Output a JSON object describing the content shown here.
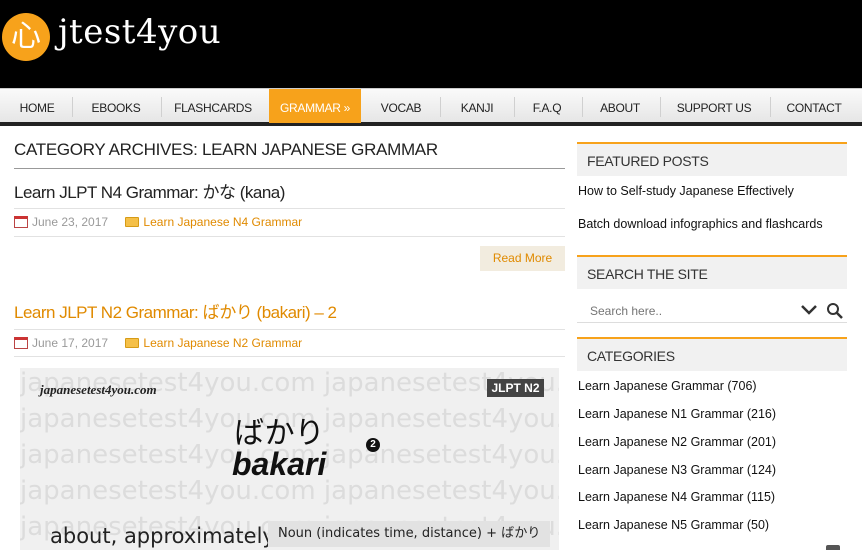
{
  "header": {
    "logo_glyph": "心",
    "site_name": "jtest4you"
  },
  "nav": {
    "items": [
      {
        "label": "HOME"
      },
      {
        "label": "EBOOKS"
      },
      {
        "label": "FLASHCARDS"
      },
      {
        "label": "GRAMMAR »",
        "active": true
      },
      {
        "label": "VOCAB"
      },
      {
        "label": "KANJI"
      },
      {
        "label": "F.A.Q"
      },
      {
        "label": "ABOUT"
      },
      {
        "label": "SUPPORT US"
      },
      {
        "label": "CONTACT"
      }
    ],
    "accent": "#f7a21b"
  },
  "main": {
    "category_title": "CATEGORY ARCHIVES: LEARN JAPANESE GRAMMAR",
    "posts": [
      {
        "title": "Learn JLPT N4 Grammar: かな (kana)",
        "title_color": "#222222",
        "date": "June 23, 2017",
        "category": "Learn Japanese N4 Grammar",
        "read_more": "Read More"
      },
      {
        "title": "Learn JLPT N2 Grammar: ばかり (bakari) – 2",
        "title_color": "#e08a00",
        "date": "June 17, 2017",
        "category": "Learn Japanese N2 Grammar"
      }
    ],
    "infographic": {
      "site": "japanesetest4you.com",
      "badge": "JLPT N2",
      "japanese": "ばかり",
      "number": "2",
      "romaji": "bakari",
      "meaning": "about, approximately",
      "pattern": "Noun (indicates time, distance) + ばかり",
      "watermark": "japanesetest4you.com japanesetest4you.com"
    }
  },
  "sidebar": {
    "featured": {
      "heading": "FEATURED POSTS",
      "links": [
        "How to Self-study Japanese Effectively",
        "Batch download infographics and flashcards"
      ]
    },
    "search": {
      "heading": "SEARCH THE SITE",
      "placeholder": "Search here.."
    },
    "categories": {
      "heading": "CATEGORIES",
      "items": [
        "Learn Japanese Grammar (706)",
        "Learn Japanese N1 Grammar (216)",
        "Learn Japanese N2 Grammar (201)",
        "Learn Japanese N3 Grammar (124)",
        "Learn Japanese N4 Grammar (115)",
        "Learn Japanese N5 Grammar (50)"
      ]
    }
  }
}
